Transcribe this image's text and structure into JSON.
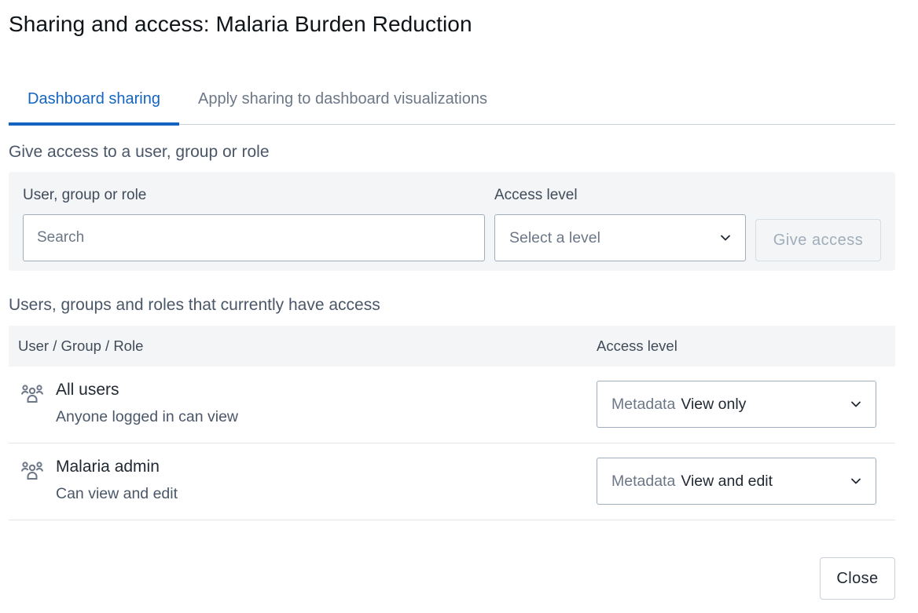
{
  "dialog": {
    "title": "Sharing and access: Malaria Burden Reduction"
  },
  "tabs": [
    {
      "label": "Dashboard sharing",
      "active": true
    },
    {
      "label": "Apply sharing to dashboard visualizations",
      "active": false
    }
  ],
  "give_access": {
    "heading": "Give access to a user, group or role",
    "user_label": "User, group or role",
    "search_placeholder": "Search",
    "level_label": "Access level",
    "level_placeholder": "Select a level",
    "button_label": "Give access"
  },
  "current_access": {
    "heading": "Users, groups and roles that currently have access",
    "columns": {
      "entity": "User / Group / Role",
      "level": "Access level"
    },
    "rows": [
      {
        "name": "All users",
        "description": "Anyone logged in can view",
        "prefix": "Metadata",
        "level": "View only",
        "icon": "users-group-icon"
      },
      {
        "name": "Malaria admin",
        "description": "Can view and edit",
        "prefix": "Metadata",
        "level": "View and edit",
        "icon": "users-group-icon"
      }
    ]
  },
  "footer": {
    "close_label": "Close"
  },
  "colors": {
    "accent": "#1565c0",
    "panel_bg": "#f3f5f7",
    "border": "#a0adba"
  }
}
